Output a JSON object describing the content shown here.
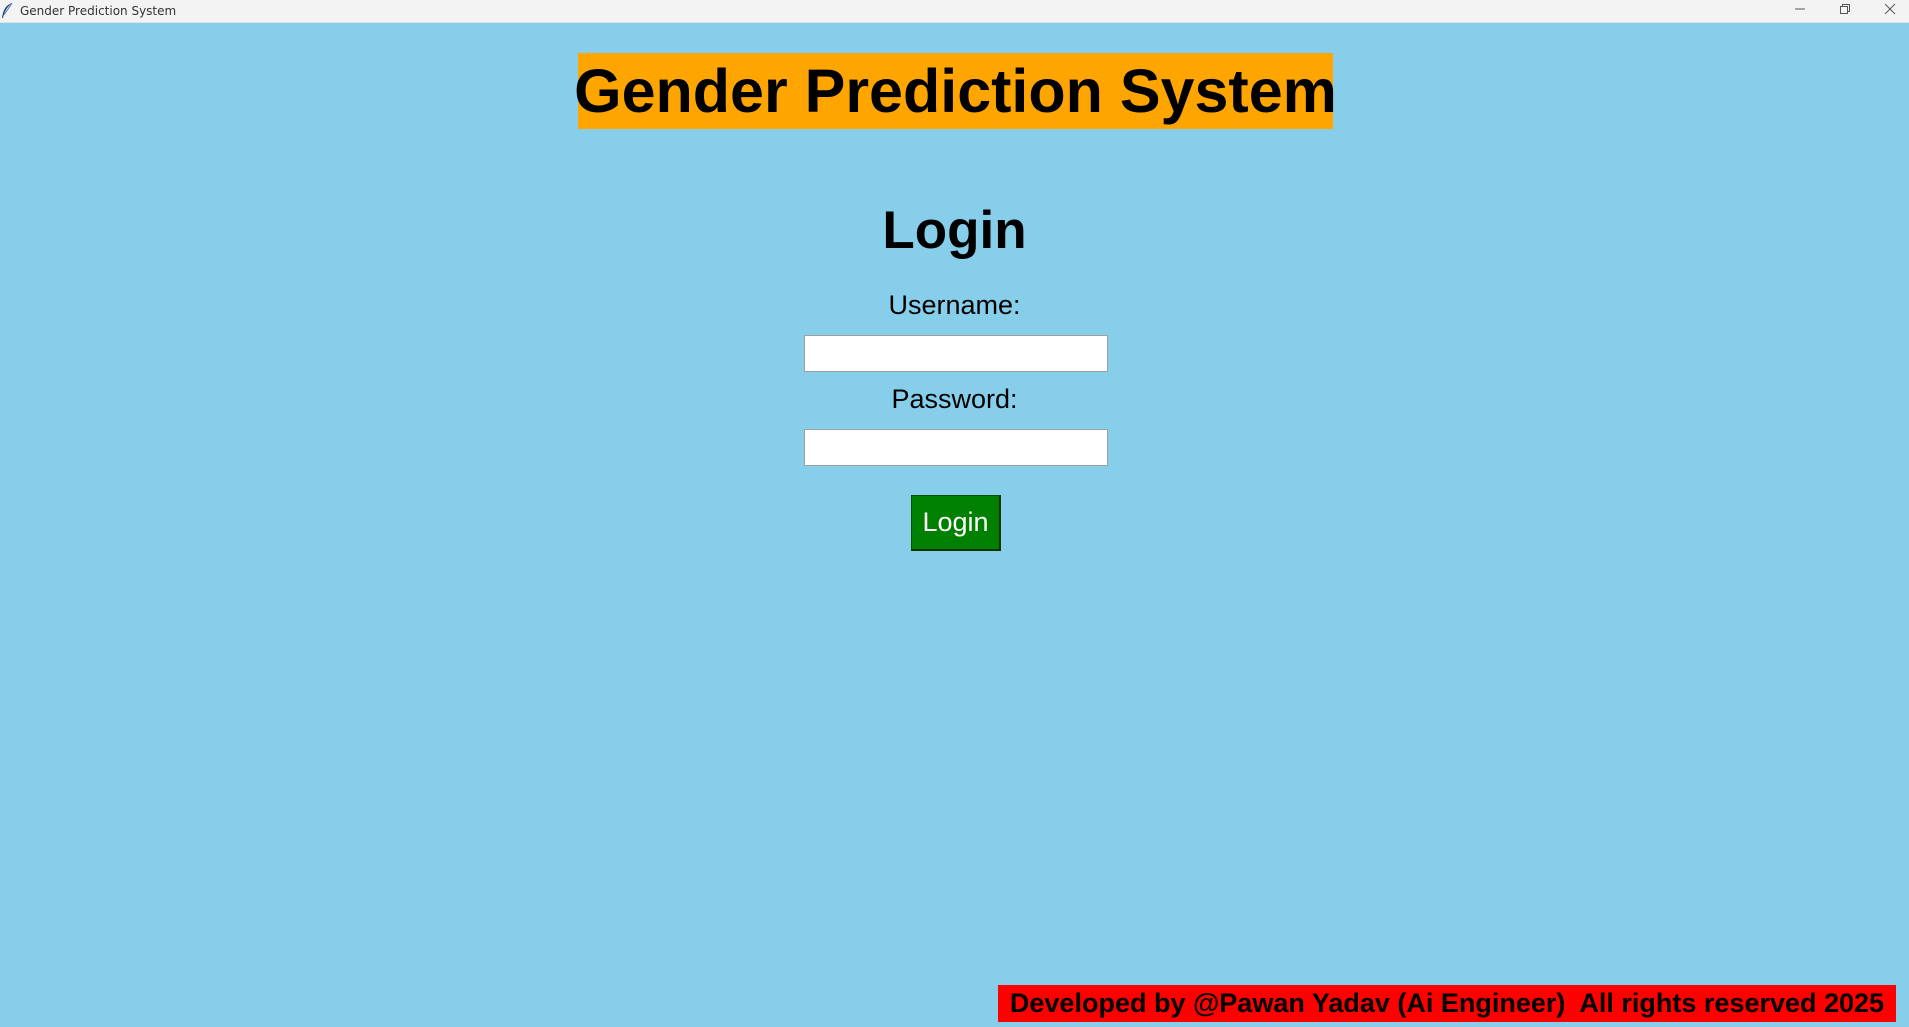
{
  "window": {
    "title": "Gender Prediction System",
    "app_icon": "feather-icon",
    "controls": {
      "minimize_icon": "minimize-icon",
      "maximize_icon": "restore-icon",
      "close_icon": "close-icon"
    }
  },
  "header": {
    "title": "Gender Prediction System"
  },
  "login": {
    "heading": "Login",
    "username_label": "Username:",
    "username_value": "",
    "password_label": "Password:",
    "password_value": "",
    "submit_label": "Login"
  },
  "footer": {
    "text": "Developed by @Pawan Yadav (Ai Engineer)  All rights reserved 2025"
  },
  "colors": {
    "background": "#87CEEB",
    "title_bg": "#FFA500",
    "button_bg": "#008000",
    "footer_bg": "#FF0000"
  }
}
